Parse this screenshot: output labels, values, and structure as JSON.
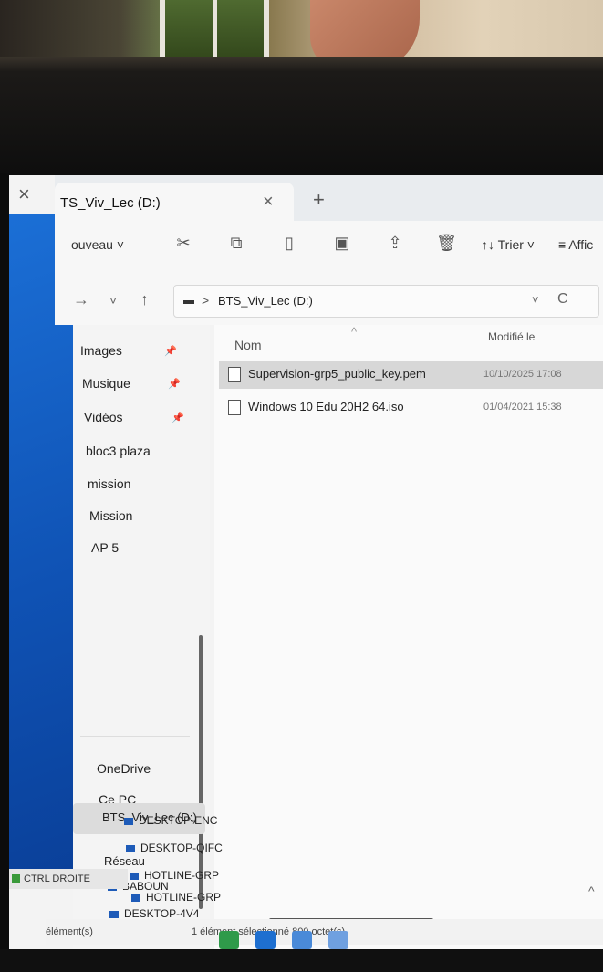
{
  "explorer": {
    "close_glyph": "×",
    "tab": {
      "title": "TS_Viv_Lec (D:)",
      "close_glyph": "×",
      "new_glyph": "+"
    },
    "toolbar": {
      "new_label": "ouveau ˅",
      "icons": [
        "cut-icon",
        "copy-icon",
        "paste-icon",
        "rename-icon",
        "share-icon",
        "delete-icon"
      ],
      "sort_label": "↑↓ Trier ˅",
      "view_label": "≡ Affic"
    },
    "address": {
      "back": "→",
      "down": "˅",
      "up": "↑",
      "separator": ">",
      "path": "BTS_Viv_Lec (D:)",
      "chevron": "˅",
      "refresh": "C"
    },
    "sidebar": {
      "pinned": [
        {
          "label": "Images",
          "pin": "📌"
        },
        {
          "label": "Musique",
          "pin": "📌"
        },
        {
          "label": "Vidéos",
          "pin": "📌"
        }
      ],
      "folders": [
        "bloc3 plaza",
        "mission",
        "Mission",
        "AP 5"
      ],
      "locations": [
        "OneDrive",
        "Ce PC",
        "BTS_Viv_Lec (D:)",
        "Réseau"
      ],
      "network": [
        "BABOUN",
        "DESKTOP-4V4",
        "DESKTOP-ENC",
        "DESKTOP-QIFC",
        "HOTLINE-GRP",
        "HOTLINE-GRP",
        "HOTLINE-GRP",
        "HOTLINE-GRP"
      ]
    },
    "columns": {
      "name": "Nom",
      "sort_glyph": "^",
      "date": "Modifié le"
    },
    "files": [
      {
        "name": "Supervision-grp5_public_key.pem",
        "date": "10/10/2025 17:08",
        "selected": true
      },
      {
        "name": "Windows 10 Edu 20H2 64.iso",
        "date": "01/04/2021 15:38",
        "selected": false
      }
    ],
    "status": {
      "count": "élément(s)",
      "selection": "1 élément sélectionné  800 octet(s)"
    },
    "ctrl_label": "CTRL DROITE"
  },
  "colors": {
    "accent_blue": "#0f52b4",
    "selection": "#d7d7d7"
  }
}
